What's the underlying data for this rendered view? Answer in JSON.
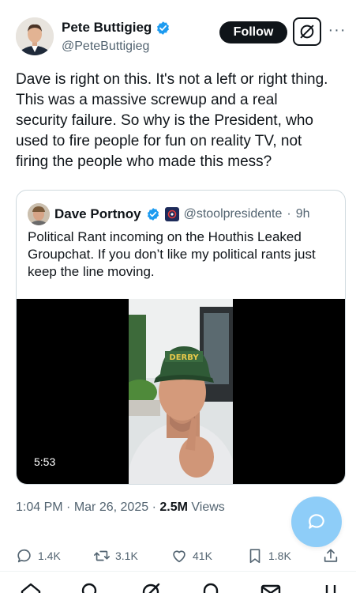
{
  "author": {
    "display_name": "Pete Buttigieg",
    "handle": "@PeteButtigieg",
    "verified": true
  },
  "header": {
    "follow_label": "Follow",
    "grok_icon": "grok-icon",
    "more_icon": "more-icon",
    "more_label": "···"
  },
  "tweet": {
    "text": "Dave is right on this. It's not a left or right thing. This was a massive screwup and a real security failure. So why is the President, who used to fire people for fun on reality TV, not firing the people who made this mess?"
  },
  "quote": {
    "display_name": "Dave Portnoy",
    "handle": "@stoolpresidente",
    "separator": "·",
    "time": "9h",
    "text": "Political Rant incoming on the Houthis Leaked Groupchat.   If you don’t like my political rants just keep the line moving.",
    "video_duration": "5:53"
  },
  "meta": {
    "time": "1:04 PM",
    "date": "Mar 26, 2025",
    "views_count": "2.5M",
    "views_label": "Views",
    "dot": "·"
  },
  "actions": {
    "replies": "1.4K",
    "reposts": "3.1K",
    "likes": "41K",
    "bookmarks": "1.8K"
  },
  "colors": {
    "text": "#0f1419",
    "secondary": "#536471",
    "verified_blue": "#1d9bf0",
    "fab_blue": "#8ecdf8",
    "border": "#cfd9de"
  }
}
